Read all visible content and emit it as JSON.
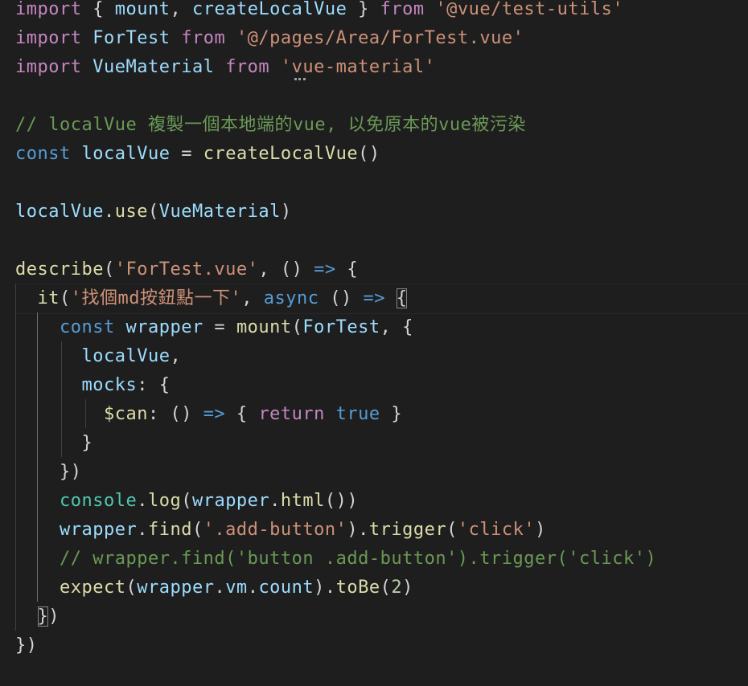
{
  "editor": {
    "language": "javascript",
    "theme_background": "#1e1e1e",
    "lines": {
      "l1": {
        "import": "import",
        "brace_open": " { ",
        "mount": "mount",
        "comma": ", ",
        "createLocalVue": "createLocalVue",
        "brace_close": " } ",
        "from": "from",
        "space": " ",
        "src": "'@vue/test-utils'"
      },
      "l2": {
        "import": "import",
        "space1": " ",
        "ForTest": "ForTest",
        "space2": " ",
        "from": "from",
        "space3": " ",
        "src": "'@/pages/Area/ForTest.vue'"
      },
      "l3": {
        "import": "import",
        "space1": " ",
        "VueMaterial": "VueMaterial",
        "space2": " ",
        "from": "from",
        "space3": " ",
        "src": "'vue-material'"
      },
      "l5": {
        "comment": "// localVue 複製一個本地端的vue, 以免原本的vue被污染"
      },
      "l6": {
        "const": "const",
        "space1": " ",
        "localVue": "localVue",
        "eq": " = ",
        "createLocalVue": "createLocalVue",
        "parens": "()"
      },
      "l8": {
        "localVue": "localVue",
        "dot": ".",
        "use": "use",
        "open": "(",
        "VueMaterial": "VueMaterial",
        "close": ")"
      },
      "l10": {
        "describe": "describe",
        "open": "(",
        "name": "'ForTest.vue'",
        "sep": ", () ",
        "arrow": "=>",
        "brace": " {"
      },
      "l11": {
        "indent": "  ",
        "it": "it",
        "open": "(",
        "name": "'找個md按鈕點一下'",
        "comma": ", ",
        "async": "async",
        "parens": " () ",
        "arrow": "=>",
        "space": " ",
        "brace": "{"
      },
      "l12": {
        "indent": "    ",
        "const": "const",
        "space1": " ",
        "wrapper": "wrapper",
        "eq": " = ",
        "mount": "mount",
        "open": "(",
        "ForTest": "ForTest",
        "rest": ", {"
      },
      "l13": {
        "indent": "      ",
        "localVue": "localVue",
        "comma": ","
      },
      "l14": {
        "indent": "      ",
        "mocks": "mocks",
        "rest": ": {"
      },
      "l15": {
        "indent": "        ",
        "can": "$can",
        "colon": ": () ",
        "arrow": "=>",
        "brace_open": " { ",
        "return": "return",
        "space": " ",
        "true": "true",
        "brace_close": " }"
      },
      "l16": {
        "indent": "      ",
        "brace": "}"
      },
      "l17": {
        "indent": "    ",
        "close": "})"
      },
      "l18": {
        "indent": "    ",
        "console": "console",
        "dot1": ".",
        "log": "log",
        "open": "(",
        "wrapper": "wrapper",
        "dot2": ".",
        "html": "html",
        "close": "())"
      },
      "l19": {
        "indent": "    ",
        "wrapper": "wrapper",
        "dot1": ".",
        "find": "find",
        "open1": "(",
        "sel": "'.add-button'",
        "close1": ").",
        "trigger": "trigger",
        "open2": "(",
        "evt": "'click'",
        "close2": ")"
      },
      "l20": {
        "indent": "    ",
        "comment": "// wrapper.find('button .add-button').trigger('click')"
      },
      "l21": {
        "indent": "    ",
        "expect": "expect",
        "open": "(",
        "wrapper": "wrapper",
        "dot1": ".",
        "vm": "vm",
        "dot2": ".",
        "count": "count",
        "close1": ").",
        "toBe": "toBe",
        "open2": "(",
        "num": "2",
        "close2": ")"
      },
      "l22": {
        "indent": "  ",
        "brace": "}",
        "paren": ")"
      },
      "l23": {
        "text": "})"
      }
    }
  }
}
